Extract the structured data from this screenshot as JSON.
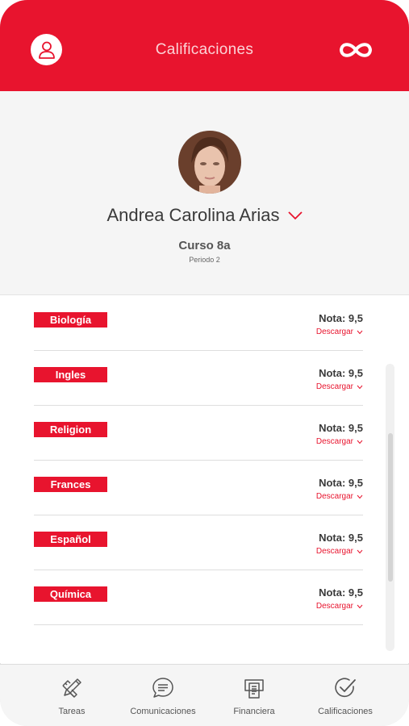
{
  "header": {
    "title": "Calificaciones"
  },
  "profile": {
    "name": "Andrea Carolina Arias",
    "course": "Curso 8a",
    "period": "Periodo 2"
  },
  "grades": [
    {
      "subject": "Biología",
      "grade": "Nota: 9,5",
      "action": "Descargar"
    },
    {
      "subject": "Ingles",
      "grade": "Nota: 9,5",
      "action": "Descargar"
    },
    {
      "subject": "Religion",
      "grade": "Nota: 9,5",
      "action": "Descargar"
    },
    {
      "subject": "Frances",
      "grade": "Nota: 9,5",
      "action": "Descargar"
    },
    {
      "subject": "Español",
      "grade": "Nota: 9,5",
      "action": "Descargar"
    },
    {
      "subject": "Química",
      "grade": "Nota: 9,5",
      "action": "Descargar"
    }
  ],
  "nav": [
    {
      "label": "Tareas",
      "icon": "pencil-ruler-icon"
    },
    {
      "label": "Comunicaciones",
      "icon": "chat-bubble-icon"
    },
    {
      "label": "Financiera",
      "icon": "documents-icon"
    },
    {
      "label": "Calificaciones",
      "icon": "check-circle-icon"
    }
  ],
  "colors": {
    "accent": "#e8142e",
    "background": "#f5f5f5"
  }
}
